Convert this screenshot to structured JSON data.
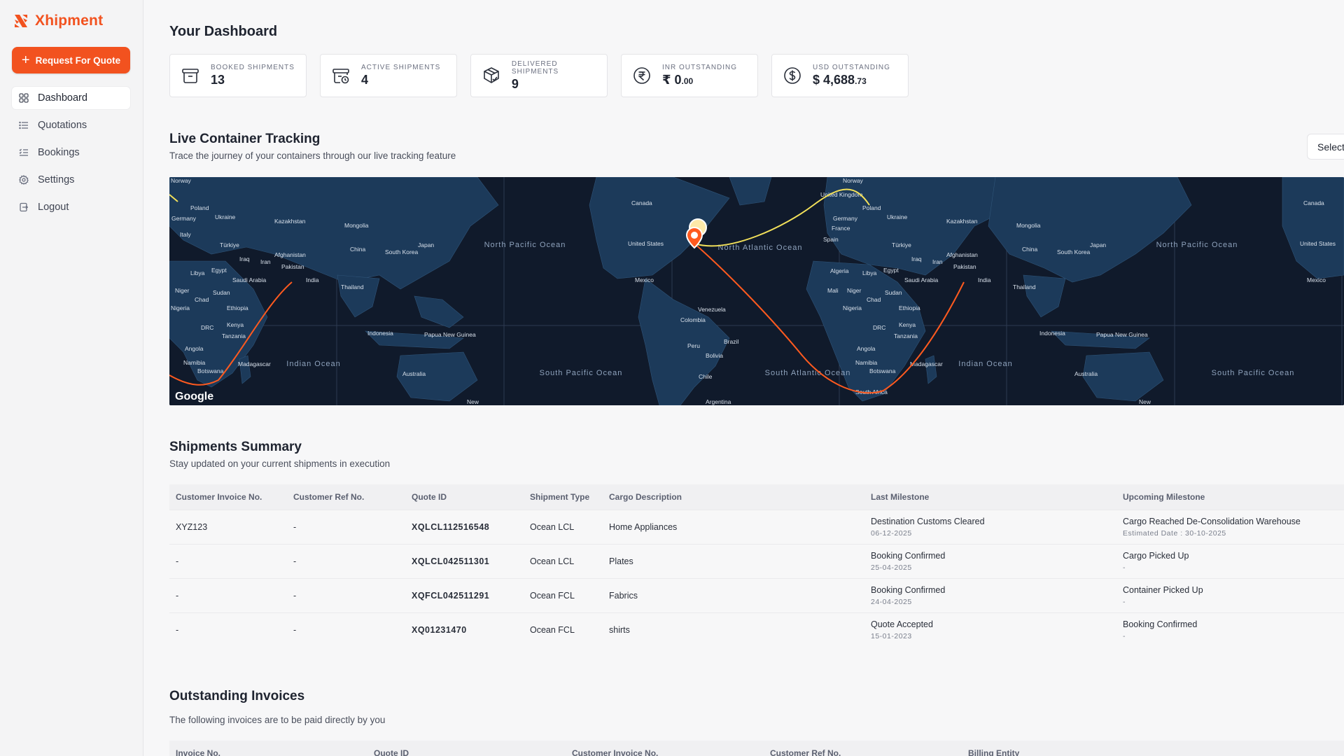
{
  "brand": {
    "name": "Xhipment",
    "color": "#f2521f"
  },
  "sidebar": {
    "rfq_label": "Request For Quote",
    "items": [
      {
        "label": "Dashboard",
        "icon": "grid-icon",
        "active": true
      },
      {
        "label": "Quotations",
        "icon": "list-icon",
        "active": false
      },
      {
        "label": "Bookings",
        "icon": "checklist-icon",
        "active": false
      },
      {
        "label": "Settings",
        "icon": "gear-icon",
        "active": false
      },
      {
        "label": "Logout",
        "icon": "logout-icon",
        "active": false
      }
    ]
  },
  "dashboard": {
    "title": "Your Dashboard",
    "stats": [
      {
        "label": "BOOKED SHIPMENTS",
        "value": "13",
        "icon": "box-icon"
      },
      {
        "label": "ACTIVE SHIPMENTS",
        "value": "4",
        "icon": "box-clock-icon"
      },
      {
        "label": "DELIVERED SHIPMENTS",
        "value": "9",
        "icon": "package-check-icon"
      },
      {
        "label": "INR OUTSTANDING",
        "value": "₹ 0",
        "cents": ".00",
        "icon": "rupee-icon"
      },
      {
        "label": "USD OUTSTANDING",
        "value": "$ 4,688",
        "cents": ".73",
        "icon": "dollar-icon"
      }
    ]
  },
  "tracking": {
    "title": "Live Container Tracking",
    "subtitle": "Trace the journey of your containers through our live tracking feature",
    "select_label": "Select",
    "map_labels": {
      "oceans": [
        "North Pacific Ocean",
        "North Atlantic Ocean",
        "South Pacific Ocean",
        "South Atlantic Ocean",
        "Indian Ocean"
      ],
      "countries": [
        "Norway",
        "Poland",
        "Germany",
        "Ukraine",
        "Kazakhstan",
        "Mongolia",
        "China",
        "South Korea",
        "Japan",
        "Italy",
        "Türkiye",
        "Iraq",
        "Iran",
        "Afghanistan",
        "Pakistan",
        "Egypt",
        "Libya",
        "Saudi Arabia",
        "India",
        "Niger",
        "Chad",
        "Sudan",
        "Thailand",
        "Nigeria",
        "Ethiopia",
        "DRC",
        "Kenya",
        "Tanzania",
        "Angola",
        "Namibia",
        "Botswana",
        "Madagascar",
        "Indonesia",
        "Papua New Guinea",
        "Australia",
        "Canada",
        "United States",
        "Mexico",
        "Venezuela",
        "Colombia",
        "Peru",
        "Brazil",
        "Bolivia",
        "Chile",
        "Argentina",
        "United Kingdom",
        "France",
        "Spain",
        "Algeria",
        "Mali",
        "South Africa",
        "New"
      ],
      "watermark": "Google"
    }
  },
  "shipments": {
    "title": "Shipments Summary",
    "subtitle": "Stay updated on your current shipments in execution",
    "columns": [
      "Customer Invoice No.",
      "Customer Ref No.",
      "Quote ID",
      "Shipment Type",
      "Cargo Description",
      "Last Milestone",
      "Upcoming Milestone"
    ],
    "rows": [
      {
        "invoice": "XYZ123",
        "ref": "-",
        "quote": "XQLCL112516548",
        "type": "Ocean LCL",
        "cargo": "Home Appliances",
        "last": "Destination Customs Cleared",
        "last_date": "06-12-2025",
        "next": "Cargo Reached De-Consolidation Warehouse",
        "next_date": "Estimated Date : 30-10-2025"
      },
      {
        "invoice": "-",
        "ref": "-",
        "quote": "XQLCL042511301",
        "type": "Ocean LCL",
        "cargo": "Plates",
        "last": "Booking Confirmed",
        "last_date": "25-04-2025",
        "next": "Cargo Picked Up",
        "next_date": "-"
      },
      {
        "invoice": "-",
        "ref": "-",
        "quote": "XQFCL042511291",
        "type": "Ocean FCL",
        "cargo": "Fabrics",
        "last": "Booking Confirmed",
        "last_date": "24-04-2025",
        "next": "Container Picked Up",
        "next_date": "-"
      },
      {
        "invoice": "-",
        "ref": "-",
        "quote": "XQ01231470",
        "type": "Ocean FCL",
        "cargo": "shirts",
        "last": "Quote Accepted",
        "last_date": "15-01-2023",
        "next": "Booking Confirmed",
        "next_date": "-"
      }
    ]
  },
  "invoices": {
    "title": "Outstanding Invoices",
    "subtitle": "The following invoices are to be paid directly by you",
    "columns": [
      "Invoice No.",
      "Quote ID",
      "Customer Invoice No.",
      "Customer Ref No.",
      "Billing Entity"
    ]
  }
}
